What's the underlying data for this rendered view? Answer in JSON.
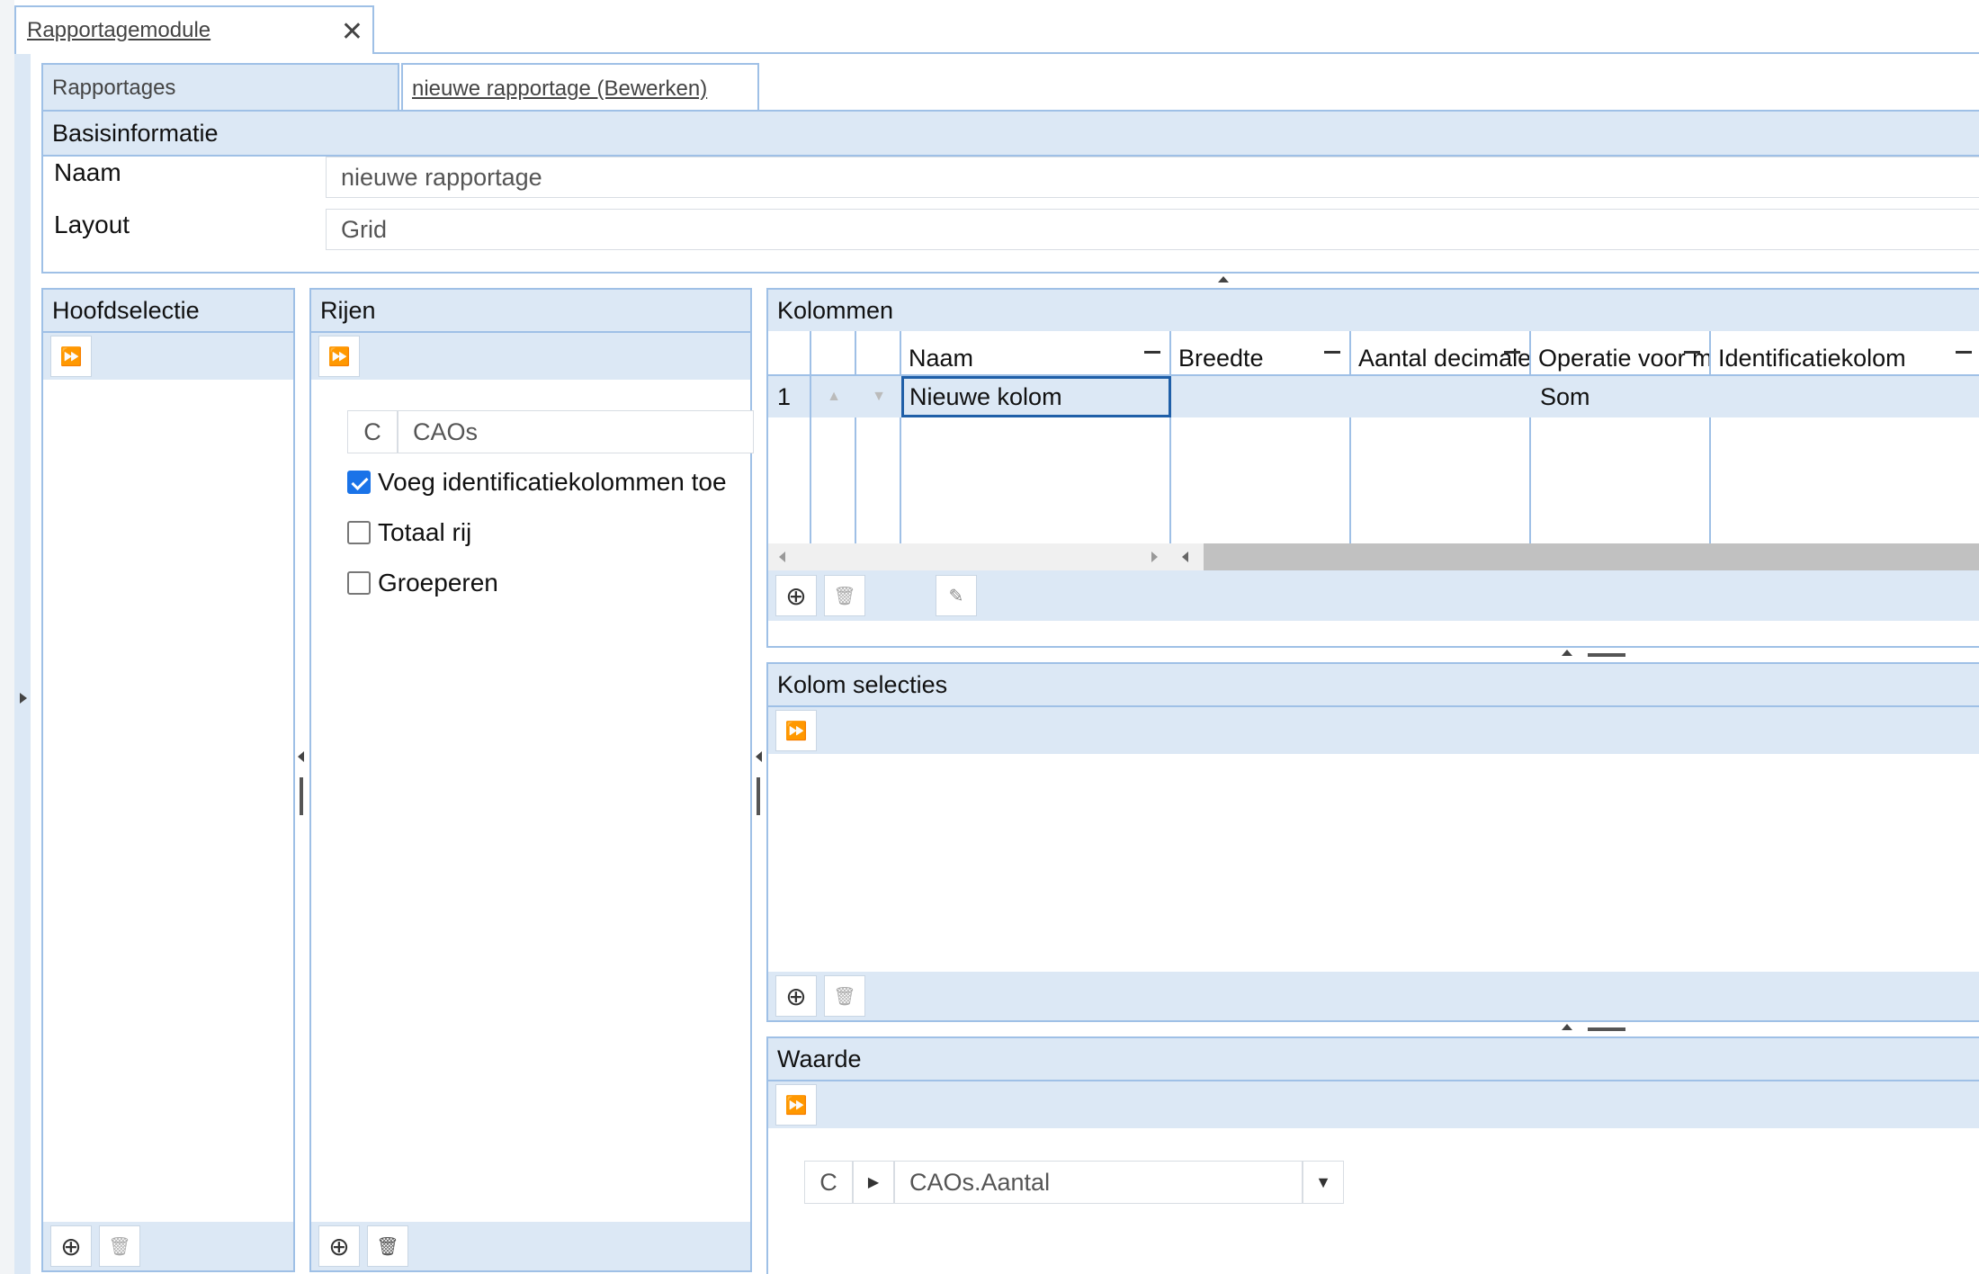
{
  "window": {
    "tab_title": "Rapportagemodule"
  },
  "tabs": [
    {
      "label": "Rapportages"
    },
    {
      "label": "nieuwe rapportage (Bewerken)"
    }
  ],
  "basis": {
    "title": "Basisinformatie",
    "naam_label": "Naam",
    "naam_value": "nieuwe rapportage",
    "layout_label": "Layout",
    "layout_value": "Grid"
  },
  "hoofdselectie": {
    "title": "Hoofdselectie"
  },
  "rijen": {
    "title": "Rijen",
    "selector_prefix": "C",
    "selector_value": "CAOs",
    "options": [
      {
        "label": "Voeg identificatiekolommen toe",
        "checked": true
      },
      {
        "label": "Totaal rij",
        "checked": false
      },
      {
        "label": "Groeperen",
        "checked": false
      }
    ]
  },
  "kolommen": {
    "title": "Kolommen",
    "columns": [
      "Naam",
      "Breedte",
      "Aantal decimalen",
      "Operatie voor maken",
      "Identificatiekolom"
    ],
    "rows": [
      {
        "nr": "1",
        "naam": "Nieuwe kolom",
        "breedte": "",
        "decimalen": "",
        "operatie": "Som",
        "ident": ""
      }
    ]
  },
  "kolom_selecties": {
    "title": "Kolom selecties"
  },
  "waarde": {
    "title": "Waarde",
    "selector_prefix": "C",
    "selector_value": "CAOs.Aantal"
  }
}
